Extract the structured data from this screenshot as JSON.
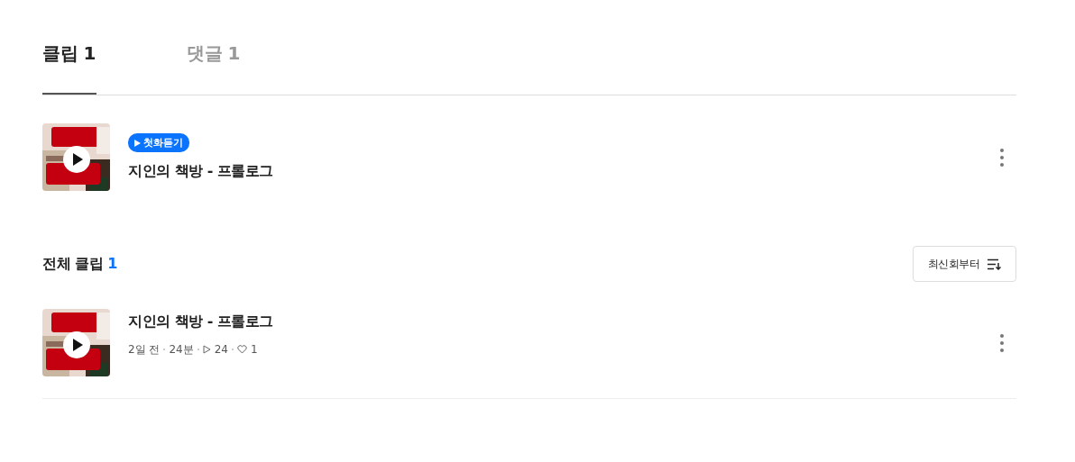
{
  "tabs": [
    {
      "label": "클립 1",
      "selected": true
    },
    {
      "label": "댓글 1",
      "selected": false
    }
  ],
  "featured": {
    "badge": "첫화듣기",
    "title": "지인의 책방 - 프롤로그"
  },
  "section": {
    "title": "전체 클립",
    "count": "1",
    "sort": "최신회부터"
  },
  "clips": [
    {
      "title": "지인의 책방 - 프롤로그",
      "date": "2일 전",
      "duration": "24분",
      "plays": "24",
      "likes": "1"
    }
  ]
}
